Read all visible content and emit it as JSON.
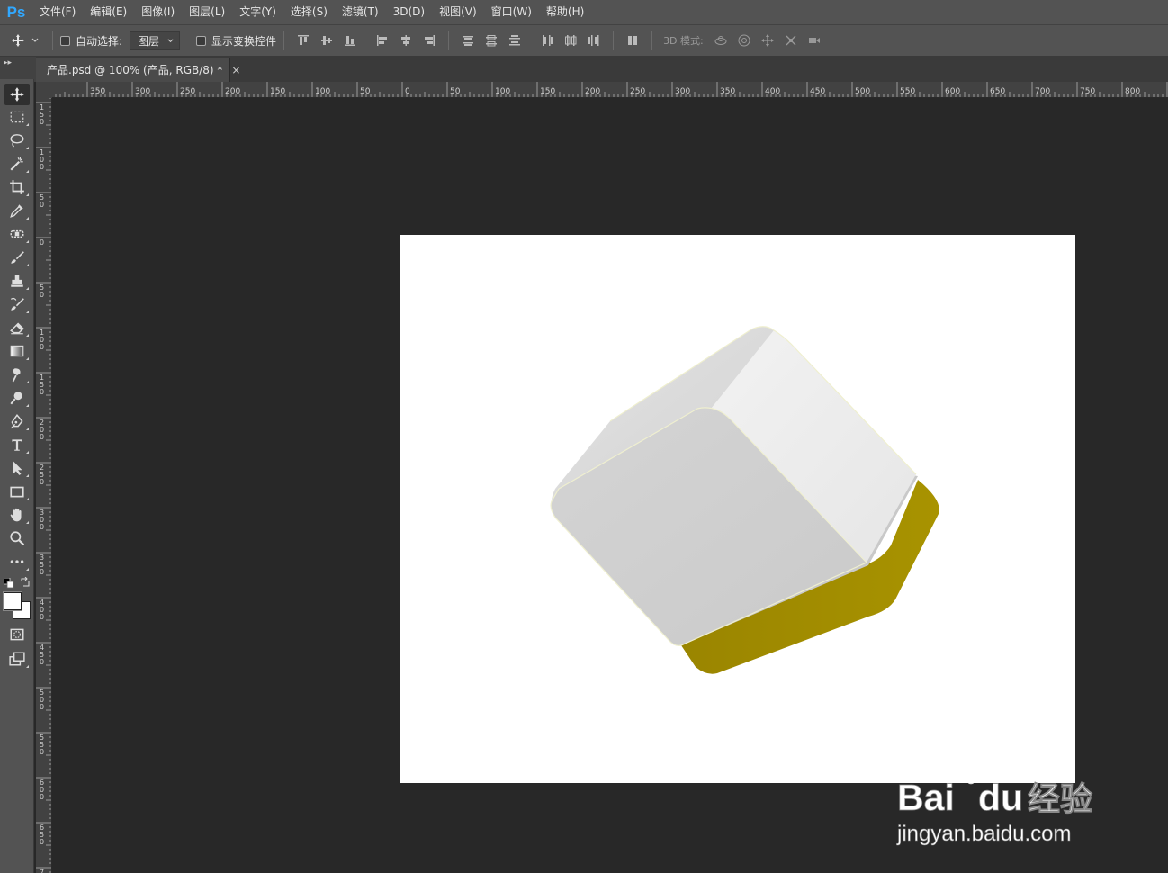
{
  "app": {
    "logo": "Ps",
    "menu": [
      "文件(F)",
      "编辑(E)",
      "图像(I)",
      "图层(L)",
      "文字(Y)",
      "选择(S)",
      "滤镜(T)",
      "3D(D)",
      "视图(V)",
      "窗口(W)",
      "帮助(H)"
    ]
  },
  "options": {
    "auto_select_label": "自动选择:",
    "auto_select_target": "图层",
    "show_transform_label": "显示变换控件",
    "mode_3d_label": "3D 模式:"
  },
  "document_tab": {
    "title": "产品.psd @ 100% (产品, RGB/8) *",
    "close": "×"
  },
  "rulers": {
    "horizontal_labels": [
      "350",
      "300",
      "250",
      "200",
      "150",
      "100",
      "50",
      "0",
      "50",
      "100",
      "150",
      "200",
      "250",
      "300",
      "350",
      "400",
      "450",
      "500",
      "550",
      "600",
      "650",
      "700",
      "750",
      "800"
    ],
    "vertical_labels": [
      "150",
      "100",
      "50",
      "0",
      "50",
      "100",
      "150",
      "200",
      "250",
      "300",
      "350",
      "400",
      "450",
      "500",
      "550",
      "600",
      "650",
      "7"
    ]
  },
  "colors": {
    "foreground": "#ffffff",
    "background": "#ffffff",
    "accent_logo": "#31a8ff",
    "product_base": "#a08c00"
  },
  "watermark": {
    "brand": "Bai",
    "brand_suffix": "du",
    "product": "经验",
    "url": "jingyan.baidu.com"
  }
}
